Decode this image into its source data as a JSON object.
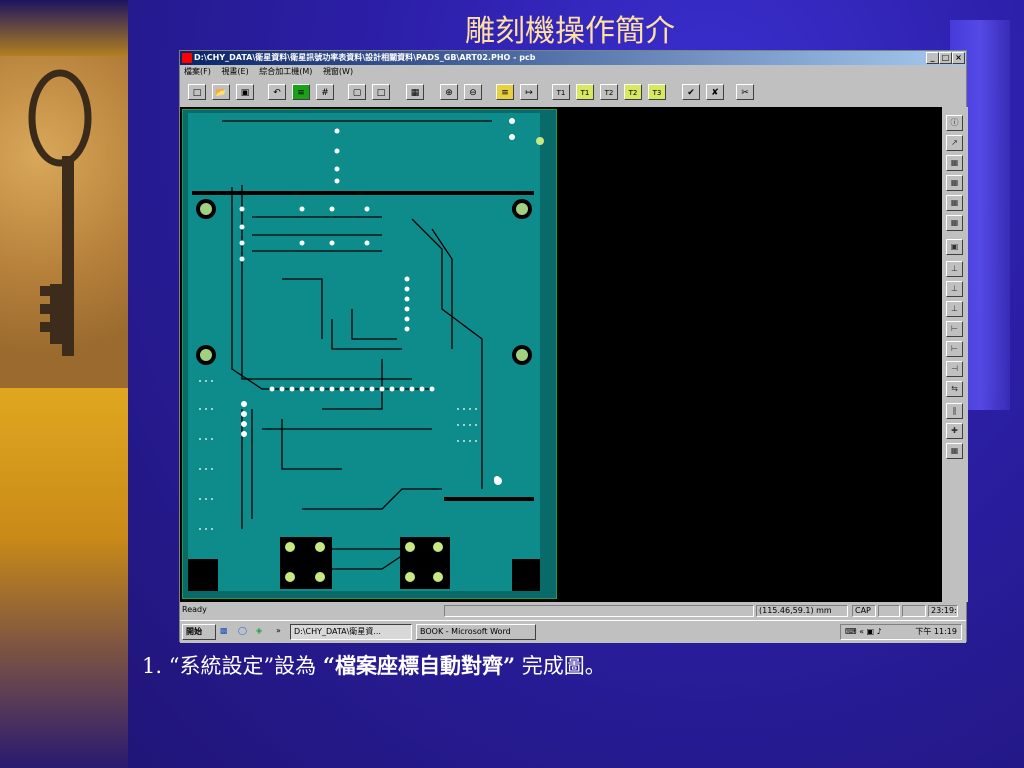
{
  "slide": {
    "title": "雕刻機操作簡介",
    "caption_prefix": "1. “系統設定”設為",
    "caption_bold": "“檔案座標自動對齊”",
    "caption_suffix": "完成圖。"
  },
  "window": {
    "title": "D:\\CHY_DATA\\衛星資料\\衛星訊號功率表資料\\設計相關資料\\PADS_GB\\ART02.PHO - pcb",
    "minimize": "_",
    "maximize": "□",
    "close": "×"
  },
  "menu": [
    "檔案(F)",
    "視畫(E)",
    "綜合加工機(M)",
    "視窗(W)"
  ],
  "toolbar": {
    "buttons": [
      "new-file",
      "open-folder",
      "save",
      "undo",
      "layer-green",
      "grid",
      "zoom-box",
      "zoom-window",
      "calculator",
      "zoom-in",
      "zoom-out",
      "layer-select",
      "measure",
      "tool-t1",
      "tool-t1-color",
      "tool-t2",
      "tool-t2-color",
      "tool-t3-color",
      "drill",
      "route",
      "cut"
    ],
    "labels": {
      "t1": "T1",
      "t2": "T2",
      "t3": "T3"
    }
  },
  "status": {
    "ready": "Ready",
    "coords": "(115.46,59.1) mm",
    "caps": "CAP",
    "time": "23:19:"
  },
  "taskbar": {
    "start": "開始",
    "quick_more": "»",
    "tasks": [
      "D:\\CHY_DATA\\衛星資...",
      "BOOK - Microsoft Word"
    ],
    "tray_more": "«",
    "clock": "下午 11:19"
  },
  "colors": {
    "board": "#0e8c8c",
    "canvas": "#000000",
    "slide_bg": "#2c1fa8",
    "title_text": "#ffe0a0"
  }
}
